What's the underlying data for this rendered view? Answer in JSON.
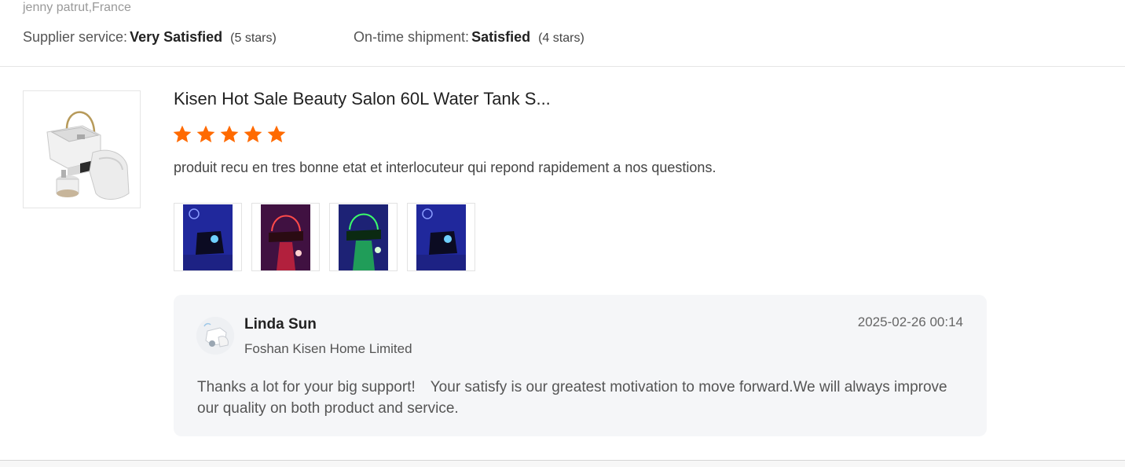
{
  "reviewer": {
    "name_location": "jenny patrut,France"
  },
  "supplier_rating": {
    "label": "Supplier service:",
    "value": "Very Satisfied",
    "stars_note": "(5 stars)"
  },
  "shipment_rating": {
    "label": "On-time shipment:",
    "value": "Satisfied",
    "stars_note": "(4 stars)"
  },
  "product": {
    "title": "Kisen Hot Sale Beauty Salon 60L Water Tank S...",
    "thumbnail_icon": "shampoo-chair-product-image",
    "rating": 5,
    "star_color": "#ff6a00"
  },
  "review": {
    "text": "produit recu en tres bonne etat et interlocuteur qui repond rapidement a nos questions.",
    "photos": [
      {
        "icon": "review-photo-blue-light",
        "tint": "#1a2fd8"
      },
      {
        "icon": "review-photo-red-light",
        "tint": "#d8202f"
      },
      {
        "icon": "review-photo-green-light",
        "tint": "#18c23a"
      },
      {
        "icon": "review-photo-blue-light",
        "tint": "#1a2fd8"
      }
    ]
  },
  "reply": {
    "name": "Linda Sun",
    "company": "Foshan Kisen Home Limited",
    "date": "2025-02-26 00:14",
    "text": "Thanks a lot for your big support!　Your satisfy is our greatest motivation to move forward.We will always improve our quality on both product and service.",
    "avatar_icon": "seller-avatar"
  }
}
